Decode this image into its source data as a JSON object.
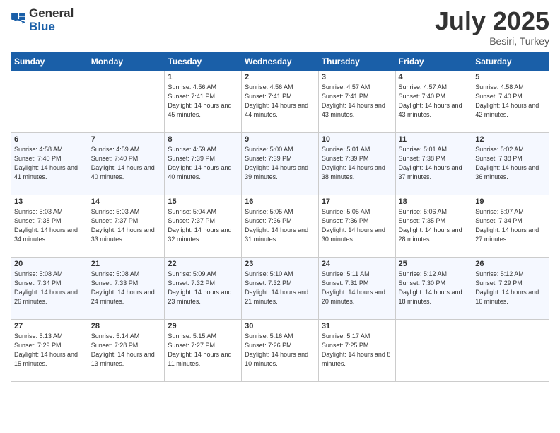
{
  "logo": {
    "line1": "General",
    "line2": "Blue"
  },
  "title": "July 2025",
  "location": "Besiri, Turkey",
  "days_header": [
    "Sunday",
    "Monday",
    "Tuesday",
    "Wednesday",
    "Thursday",
    "Friday",
    "Saturday"
  ],
  "weeks": [
    [
      {
        "day": "",
        "info": ""
      },
      {
        "day": "",
        "info": ""
      },
      {
        "day": "1",
        "info": "Sunrise: 4:56 AM\nSunset: 7:41 PM\nDaylight: 14 hours and 45 minutes."
      },
      {
        "day": "2",
        "info": "Sunrise: 4:56 AM\nSunset: 7:41 PM\nDaylight: 14 hours and 44 minutes."
      },
      {
        "day": "3",
        "info": "Sunrise: 4:57 AM\nSunset: 7:41 PM\nDaylight: 14 hours and 43 minutes."
      },
      {
        "day": "4",
        "info": "Sunrise: 4:57 AM\nSunset: 7:40 PM\nDaylight: 14 hours and 43 minutes."
      },
      {
        "day": "5",
        "info": "Sunrise: 4:58 AM\nSunset: 7:40 PM\nDaylight: 14 hours and 42 minutes."
      }
    ],
    [
      {
        "day": "6",
        "info": "Sunrise: 4:58 AM\nSunset: 7:40 PM\nDaylight: 14 hours and 41 minutes."
      },
      {
        "day": "7",
        "info": "Sunrise: 4:59 AM\nSunset: 7:40 PM\nDaylight: 14 hours and 40 minutes."
      },
      {
        "day": "8",
        "info": "Sunrise: 4:59 AM\nSunset: 7:39 PM\nDaylight: 14 hours and 40 minutes."
      },
      {
        "day": "9",
        "info": "Sunrise: 5:00 AM\nSunset: 7:39 PM\nDaylight: 14 hours and 39 minutes."
      },
      {
        "day": "10",
        "info": "Sunrise: 5:01 AM\nSunset: 7:39 PM\nDaylight: 14 hours and 38 minutes."
      },
      {
        "day": "11",
        "info": "Sunrise: 5:01 AM\nSunset: 7:38 PM\nDaylight: 14 hours and 37 minutes."
      },
      {
        "day": "12",
        "info": "Sunrise: 5:02 AM\nSunset: 7:38 PM\nDaylight: 14 hours and 36 minutes."
      }
    ],
    [
      {
        "day": "13",
        "info": "Sunrise: 5:03 AM\nSunset: 7:38 PM\nDaylight: 14 hours and 34 minutes."
      },
      {
        "day": "14",
        "info": "Sunrise: 5:03 AM\nSunset: 7:37 PM\nDaylight: 14 hours and 33 minutes."
      },
      {
        "day": "15",
        "info": "Sunrise: 5:04 AM\nSunset: 7:37 PM\nDaylight: 14 hours and 32 minutes."
      },
      {
        "day": "16",
        "info": "Sunrise: 5:05 AM\nSunset: 7:36 PM\nDaylight: 14 hours and 31 minutes."
      },
      {
        "day": "17",
        "info": "Sunrise: 5:05 AM\nSunset: 7:36 PM\nDaylight: 14 hours and 30 minutes."
      },
      {
        "day": "18",
        "info": "Sunrise: 5:06 AM\nSunset: 7:35 PM\nDaylight: 14 hours and 28 minutes."
      },
      {
        "day": "19",
        "info": "Sunrise: 5:07 AM\nSunset: 7:34 PM\nDaylight: 14 hours and 27 minutes."
      }
    ],
    [
      {
        "day": "20",
        "info": "Sunrise: 5:08 AM\nSunset: 7:34 PM\nDaylight: 14 hours and 26 minutes."
      },
      {
        "day": "21",
        "info": "Sunrise: 5:08 AM\nSunset: 7:33 PM\nDaylight: 14 hours and 24 minutes."
      },
      {
        "day": "22",
        "info": "Sunrise: 5:09 AM\nSunset: 7:32 PM\nDaylight: 14 hours and 23 minutes."
      },
      {
        "day": "23",
        "info": "Sunrise: 5:10 AM\nSunset: 7:32 PM\nDaylight: 14 hours and 21 minutes."
      },
      {
        "day": "24",
        "info": "Sunrise: 5:11 AM\nSunset: 7:31 PM\nDaylight: 14 hours and 20 minutes."
      },
      {
        "day": "25",
        "info": "Sunrise: 5:12 AM\nSunset: 7:30 PM\nDaylight: 14 hours and 18 minutes."
      },
      {
        "day": "26",
        "info": "Sunrise: 5:12 AM\nSunset: 7:29 PM\nDaylight: 14 hours and 16 minutes."
      }
    ],
    [
      {
        "day": "27",
        "info": "Sunrise: 5:13 AM\nSunset: 7:29 PM\nDaylight: 14 hours and 15 minutes."
      },
      {
        "day": "28",
        "info": "Sunrise: 5:14 AM\nSunset: 7:28 PM\nDaylight: 14 hours and 13 minutes."
      },
      {
        "day": "29",
        "info": "Sunrise: 5:15 AM\nSunset: 7:27 PM\nDaylight: 14 hours and 11 minutes."
      },
      {
        "day": "30",
        "info": "Sunrise: 5:16 AM\nSunset: 7:26 PM\nDaylight: 14 hours and 10 minutes."
      },
      {
        "day": "31",
        "info": "Sunrise: 5:17 AM\nSunset: 7:25 PM\nDaylight: 14 hours and 8 minutes."
      },
      {
        "day": "",
        "info": ""
      },
      {
        "day": "",
        "info": ""
      }
    ]
  ]
}
